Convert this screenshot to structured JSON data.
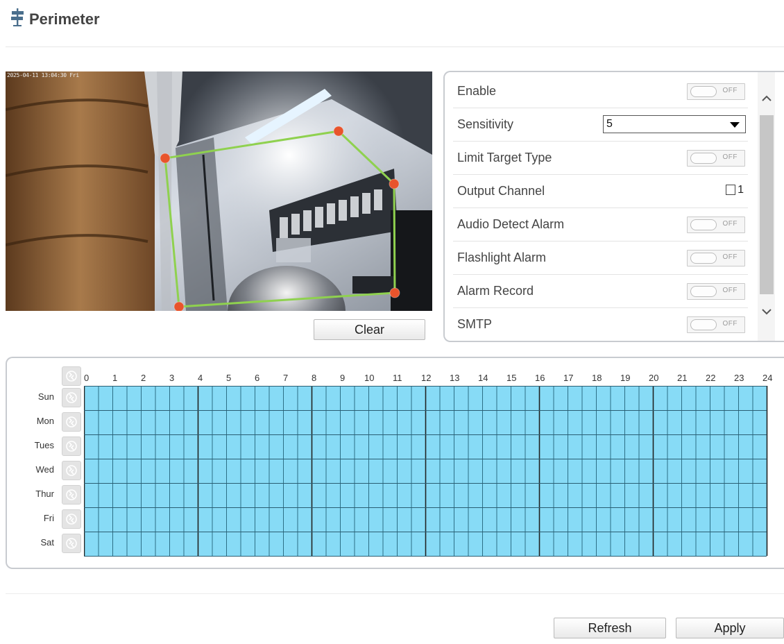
{
  "page": {
    "title": "Perimeter",
    "icon": "signpost-icon"
  },
  "video": {
    "osd_timestamp": "2025-04-11 13:04:30 Fri",
    "region_polygon_color": "#8fd14f",
    "vertex_color": "#e8542c"
  },
  "actions": {
    "clear_label": "Clear",
    "refresh_label": "Refresh",
    "apply_label": "Apply"
  },
  "settings": {
    "enable": {
      "label": "Enable",
      "state": "OFF"
    },
    "sensitivity": {
      "label": "Sensitivity",
      "value": "5"
    },
    "limit_target_type": {
      "label": "Limit Target Type",
      "state": "OFF"
    },
    "output_channel": {
      "label": "Output Channel",
      "channel": "1",
      "checked": false
    },
    "audio_detect_alarm": {
      "label": "Audio Detect Alarm",
      "state": "OFF"
    },
    "flashlight_alarm": {
      "label": "Flashlight Alarm",
      "state": "OFF"
    },
    "alarm_record": {
      "label": "Alarm Record",
      "state": "OFF"
    },
    "smtp": {
      "label": "SMTP",
      "state": "OFF"
    }
  },
  "schedule": {
    "hours": [
      "0",
      "1",
      "2",
      "3",
      "4",
      "5",
      "6",
      "7",
      "8",
      "9",
      "10",
      "11",
      "12",
      "13",
      "14",
      "15",
      "16",
      "17",
      "18",
      "19",
      "20",
      "21",
      "22",
      "23",
      "24"
    ],
    "days": [
      "Sun",
      "Mon",
      "Tues",
      "Wed",
      "Thur",
      "Fri",
      "Sat"
    ],
    "all_slots_selected": true,
    "cell_color": "#87dbf6",
    "colors": {
      "major_line": "#222222",
      "minor_line": "#2d6f86"
    }
  }
}
